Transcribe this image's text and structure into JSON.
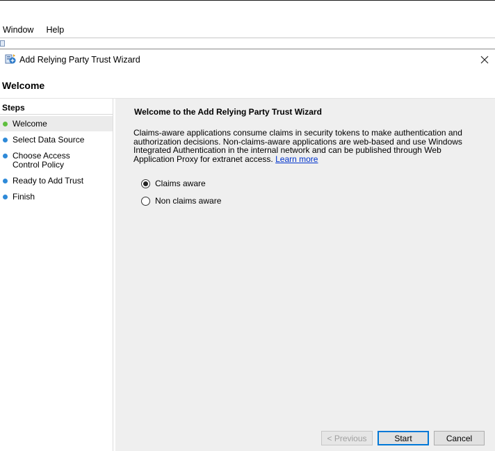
{
  "menubar": {
    "items": [
      "Window",
      "Help"
    ]
  },
  "wizard": {
    "title": "Add Relying Party Trust Wizard",
    "page_heading": "Welcome",
    "steps_header": "Steps",
    "steps": [
      {
        "label": "Welcome",
        "state": "current",
        "color": "#5fbf3f"
      },
      {
        "label": "Select Data Source",
        "state": "pending",
        "color": "#2e8ad8"
      },
      {
        "label": "Choose Access Control Policy",
        "state": "pending",
        "color": "#2e8ad8"
      },
      {
        "label": "Ready to Add Trust",
        "state": "pending",
        "color": "#2e8ad8"
      },
      {
        "label": "Finish",
        "state": "pending",
        "color": "#2e8ad8"
      }
    ],
    "content": {
      "title": "Welcome to the Add Relying Party Trust Wizard",
      "description": "Claims-aware applications consume claims in security tokens to make authentication and authorization decisions. Non-claims-aware applications are web-based and use Windows Integrated Authentication in the internal network and can be published through Web Application Proxy for extranet access.",
      "learn_more": "Learn more",
      "options": [
        {
          "label": "Claims aware",
          "selected": true
        },
        {
          "label": "Non claims aware",
          "selected": false
        }
      ]
    },
    "buttons": {
      "previous": "< Previous",
      "start": "Start",
      "cancel": "Cancel"
    }
  }
}
